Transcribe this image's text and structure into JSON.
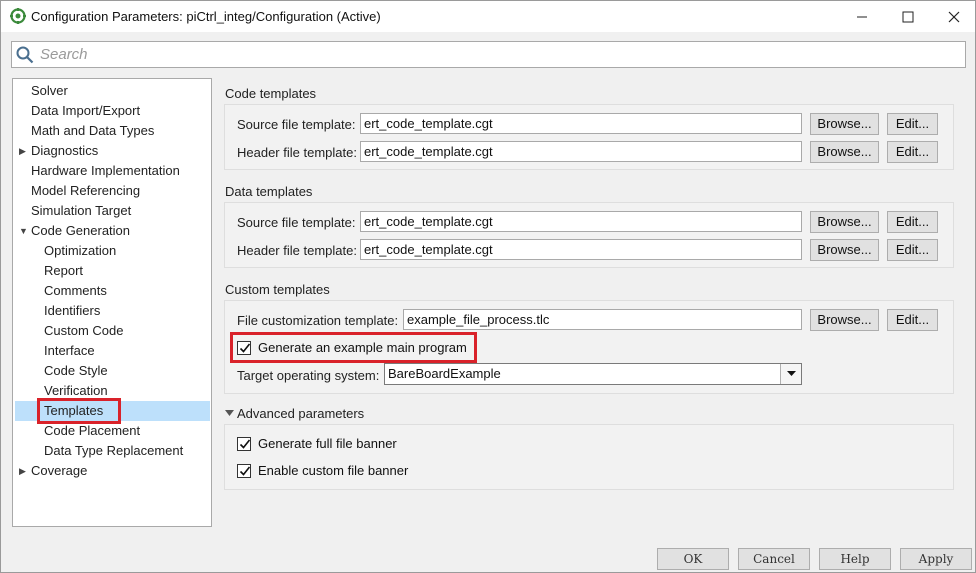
{
  "window": {
    "title": "Configuration Parameters: piCtrl_integ/Configuration (Active)"
  },
  "search": {
    "placeholder": "Search",
    "value": ""
  },
  "tree": {
    "items": [
      {
        "label": "Solver",
        "expandable": false
      },
      {
        "label": "Data Import/Export",
        "expandable": false
      },
      {
        "label": "Math and Data Types",
        "expandable": false
      },
      {
        "label": "Diagnostics",
        "expandable": true,
        "expanded": false
      },
      {
        "label": "Hardware Implementation",
        "expandable": false
      },
      {
        "label": "Model Referencing",
        "expandable": false
      },
      {
        "label": "Simulation Target",
        "expandable": false
      },
      {
        "label": "Code Generation",
        "expandable": true,
        "expanded": true
      },
      {
        "label": "Optimization",
        "child": true
      },
      {
        "label": "Report",
        "child": true
      },
      {
        "label": "Comments",
        "child": true
      },
      {
        "label": "Identifiers",
        "child": true
      },
      {
        "label": "Custom Code",
        "child": true
      },
      {
        "label": "Interface",
        "child": true
      },
      {
        "label": "Code Style",
        "child": true
      },
      {
        "label": "Verification",
        "child": true
      },
      {
        "label": "Templates",
        "child": true,
        "selected": true
      },
      {
        "label": "Code Placement",
        "child": true
      },
      {
        "label": "Data Type Replacement",
        "child": true
      },
      {
        "label": "Coverage",
        "expandable": true,
        "expanded": false
      }
    ]
  },
  "code_templates": {
    "title": "Code templates",
    "source_label": "Source file template:",
    "source_value": "ert_code_template.cgt",
    "header_label": "Header file template:",
    "header_value": "ert_code_template.cgt"
  },
  "data_templates": {
    "title": "Data templates",
    "source_label": "Source file template:",
    "source_value": "ert_code_template.cgt",
    "header_label": "Header file template:",
    "header_value": "ert_code_template.cgt"
  },
  "custom_templates": {
    "title": "Custom templates",
    "file_custom_label": "File customization template:",
    "file_custom_value": "example_file_process.tlc",
    "generate_main_label": "Generate an example main program",
    "generate_main_checked": true,
    "target_os_label": "Target operating system:",
    "target_os_value": "BareBoardExample"
  },
  "advanced": {
    "title": "Advanced parameters",
    "full_banner_label": "Generate full file banner",
    "full_banner_checked": true,
    "custom_banner_label": "Enable custom file banner",
    "custom_banner_checked": true
  },
  "buttons": {
    "browse": "Browse...",
    "edit": "Edit..."
  },
  "footer": {
    "ok": "OK",
    "cancel": "Cancel",
    "help": "Help",
    "apply": "Apply"
  },
  "colors": {
    "highlight": "#d9222a",
    "selection": "#bde0fb"
  }
}
